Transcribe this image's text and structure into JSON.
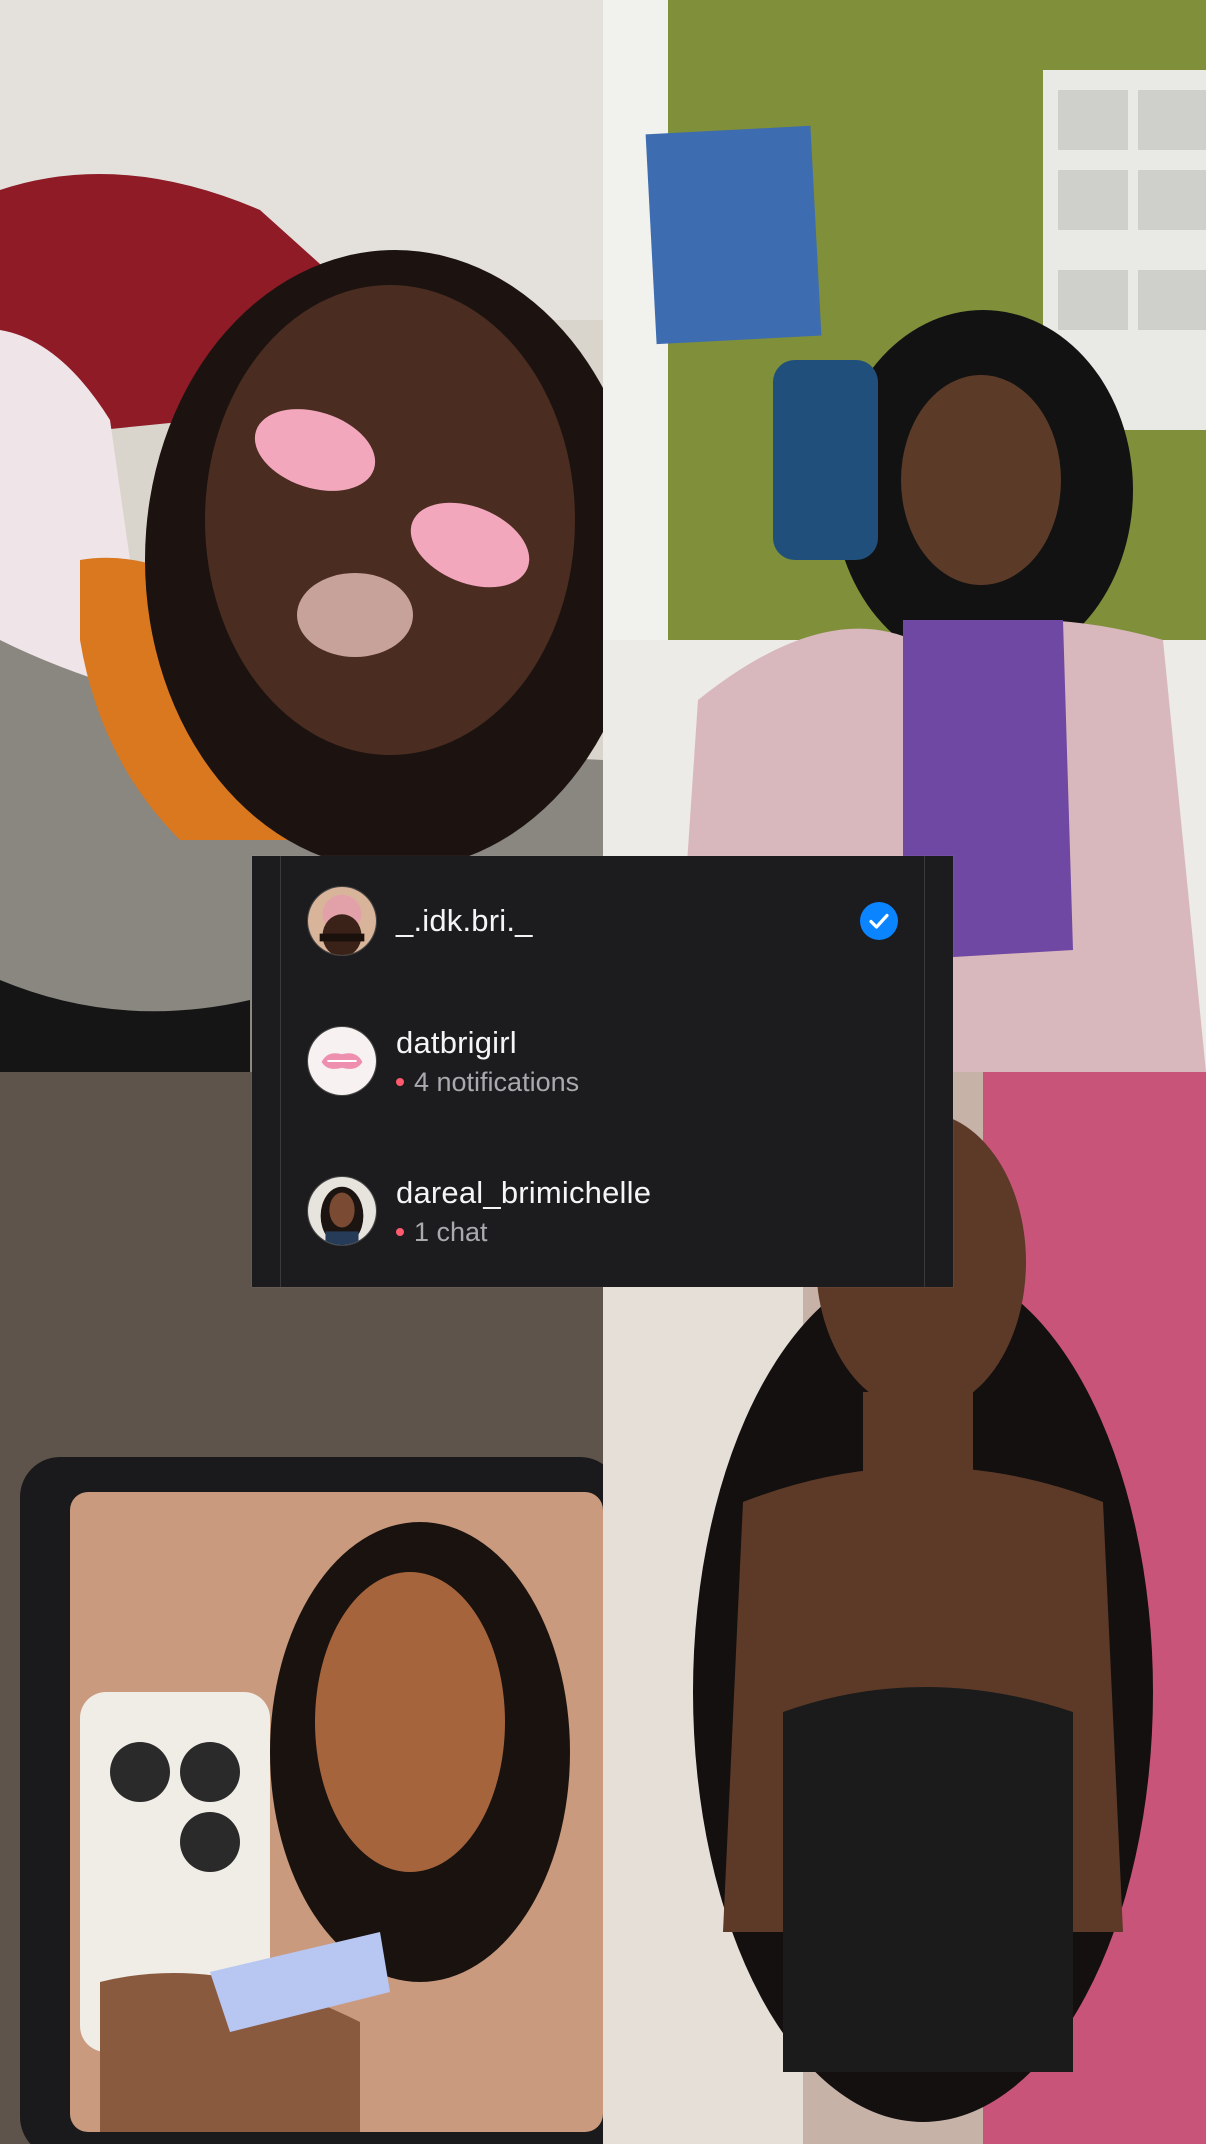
{
  "accounts": [
    {
      "username": "_.idk.bri._",
      "selected": true,
      "avatar_icon": "profile-photo-avatar"
    },
    {
      "username": "datbrigirl",
      "status": "4 notifications",
      "avatar_icon": "pink-logo-avatar"
    },
    {
      "username": "dareal_brimichelle",
      "status": "1 chat",
      "avatar_icon": "profile-photo-avatar"
    }
  ],
  "colors": {
    "panel_bg": "#1c1c1f",
    "check_blue": "#0a84ff",
    "notification_dot": "#ff5a6e",
    "username_text": "#f5f5f7",
    "status_text": "#a9a9ae"
  },
  "icons": {
    "selected": "checkmark-circle-icon",
    "status_dot": "notification-dot-icon"
  }
}
